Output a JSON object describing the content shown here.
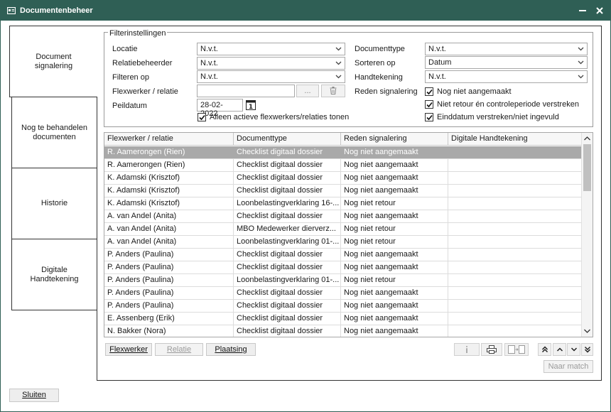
{
  "window": {
    "title": "Documentenbeheer"
  },
  "tabs": [
    {
      "label": "Document\nsignalering"
    },
    {
      "label": "Nog te behandelen\ndocumenten"
    },
    {
      "label": "Historie"
    },
    {
      "label": "Digitale\nHandtekening"
    }
  ],
  "filters": {
    "legend": "Filterinstellingen",
    "locatie": {
      "label": "Locatie",
      "value": "N.v.t."
    },
    "relatiebeheerder": {
      "label": "Relatiebeheerder",
      "value": "N.v.t."
    },
    "filteren_op": {
      "label": "Filteren op",
      "value": "N.v.t."
    },
    "flexwerker_relatie": {
      "label": "Flexwerker / relatie",
      "value": "",
      "browse": "...",
      "clear_icon": "trash-icon"
    },
    "peildatum": {
      "label": "Peildatum",
      "value": "28-02-2022",
      "calendar_icon": "calendar-icon"
    },
    "alleen_actieve": {
      "label": "Alleen actieve flexwerkers/relaties tonen",
      "checked": true
    },
    "documenttype": {
      "label": "Documenttype",
      "value": "N.v.t."
    },
    "sorteren_op": {
      "label": "Sorteren op",
      "value": "Datum"
    },
    "handtekening": {
      "label": "Handtekening",
      "value": "N.v.t."
    },
    "reden_signalering": {
      "label": "Reden signalering",
      "options": [
        {
          "label": "Nog niet aangemaakt",
          "checked": true
        },
        {
          "label": "Niet retour én controleperiode verstreken",
          "checked": true
        },
        {
          "label": "Einddatum verstreken/niet ingevuld",
          "checked": true
        }
      ]
    }
  },
  "grid": {
    "columns": [
      "Flexwerker / relatie",
      "Documenttype",
      "Reden signalering",
      "Digitale Handtekening"
    ],
    "rows": [
      {
        "flex": "R. Aamerongen (Rien)",
        "doc": "Checklist digitaal dossier",
        "reden": "Nog niet aangemaakt",
        "dh": "",
        "selected": true
      },
      {
        "flex": "R. Aamerongen (Rien)",
        "doc": "Checklist digitaal dossier",
        "reden": "Nog niet aangemaakt",
        "dh": ""
      },
      {
        "flex": "K. Adamski (Krisztof)",
        "doc": "Checklist digitaal dossier",
        "reden": "Nog niet aangemaakt",
        "dh": ""
      },
      {
        "flex": "K. Adamski (Krisztof)",
        "doc": "Checklist digitaal dossier",
        "reden": "Nog niet aangemaakt",
        "dh": ""
      },
      {
        "flex": "K. Adamski (Krisztof)",
        "doc": "Loonbelastingverklaring 16-...",
        "reden": "Nog niet retour",
        "dh": ""
      },
      {
        "flex": "A. van Andel (Anita)",
        "doc": "Checklist digitaal dossier",
        "reden": "Nog niet aangemaakt",
        "dh": ""
      },
      {
        "flex": "A. van Andel (Anita)",
        "doc": "MBO Medewerker dierverz...",
        "reden": "Nog niet retour",
        "dh": ""
      },
      {
        "flex": "A. van Andel (Anita)",
        "doc": "Loonbelastingverklaring 01-...",
        "reden": "Nog niet retour",
        "dh": ""
      },
      {
        "flex": "P. Anders (Paulina)",
        "doc": "Checklist digitaal dossier",
        "reden": "Nog niet aangemaakt",
        "dh": ""
      },
      {
        "flex": "P. Anders (Paulina)",
        "doc": "Checklist digitaal dossier",
        "reden": "Nog niet aangemaakt",
        "dh": ""
      },
      {
        "flex": "P. Anders (Paulina)",
        "doc": "Loonbelastingverklaring 01-...",
        "reden": "Nog niet retour",
        "dh": ""
      },
      {
        "flex": "P. Anders (Paulina)",
        "doc": "Checklist digitaal dossier",
        "reden": "Nog niet aangemaakt",
        "dh": ""
      },
      {
        "flex": "P. Anders (Paulina)",
        "doc": "Checklist digitaal dossier",
        "reden": "Nog niet aangemaakt",
        "dh": ""
      },
      {
        "flex": "E. Assenberg (Erik)",
        "doc": "Checklist digitaal dossier",
        "reden": "Nog niet aangemaakt",
        "dh": ""
      },
      {
        "flex": "N. Bakker (Nora)",
        "doc": "Checklist digitaal dossier",
        "reden": "Nog niet aangemaakt",
        "dh": ""
      }
    ]
  },
  "actions": {
    "flexwerker": "Flexwerker",
    "relatie": "Relatie",
    "plaatsing": "Plaatsing",
    "naar_match": "Naar match",
    "icons": [
      "info-icon",
      "print-icon",
      "export-icon",
      "first-icon",
      "up-icon",
      "down-icon",
      "last-icon"
    ]
  },
  "footer": {
    "sluiten": "Sluiten"
  },
  "colors": {
    "titlebar": "#2f5f55",
    "selected_row": "#a9a9a9"
  }
}
